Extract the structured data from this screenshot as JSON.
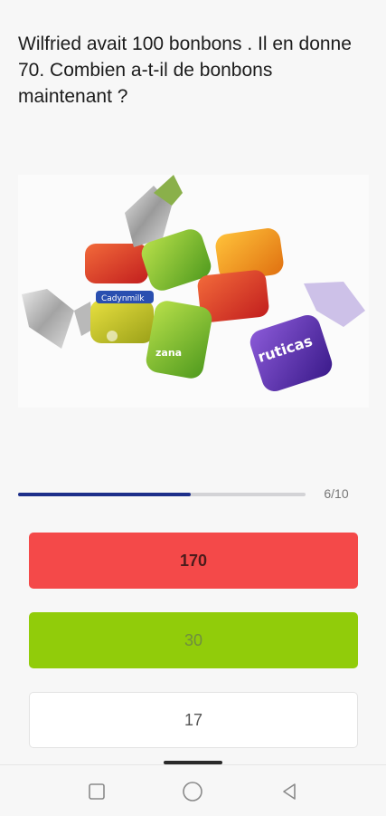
{
  "question": "Wilfried avait 100 bonbons . Il en donne 70. Combien a-t-il de bonbons maintenant ?",
  "image": {
    "subject": "candies-photo",
    "wrapper_text": [
      "ruticas",
      "zana",
      "Cadynmilk"
    ]
  },
  "progress": {
    "current": 6,
    "total": 10,
    "label": "6/10",
    "fraction": 0.6,
    "color": "#1d2f8a"
  },
  "answers": [
    {
      "label": "170",
      "state": "wrong",
      "color": "#f44949"
    },
    {
      "label": "30",
      "state": "correct",
      "color": "#91cc0a"
    },
    {
      "label": "17",
      "state": "neutral",
      "color": "#ffffff"
    }
  ],
  "navbar": {
    "buttons": [
      "recent-apps-icon",
      "home-icon",
      "back-icon"
    ]
  }
}
